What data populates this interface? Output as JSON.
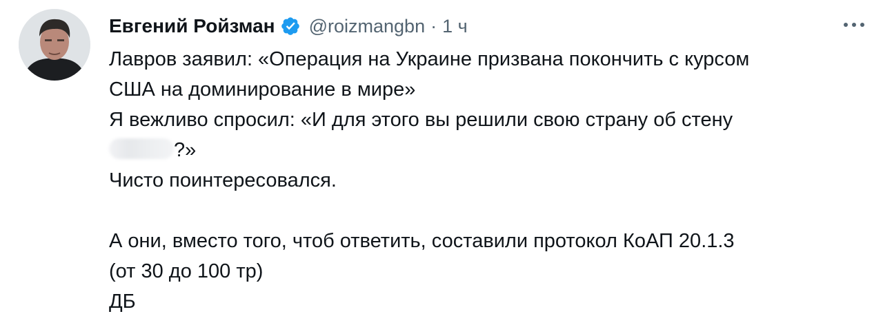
{
  "tweet": {
    "author_name": "Евгений Ройзман",
    "handle": "@roizmangbn",
    "separator": "·",
    "time": "1 ч",
    "more_label": "···",
    "lines": [
      "Лавров заявил: «Операция на Украине призвана покончить с курсом",
      "США на доминирование в мире»",
      "Я вежливо спросил: «И для этого вы решили свою страну об стену",
      "?»",
      "Чисто поинтересовался.",
      "",
      "А они, вместо того, чтоб ответить, составили протокол КоАП 20.1.3",
      "(от 30 до 100 тр)",
      "ДБ"
    ]
  },
  "icons": {
    "verified": "verified-badge-icon",
    "more": "more-dots-icon"
  },
  "colors": {
    "text": "#0f1419",
    "secondary": "#536471",
    "verified": "#1d9bf0",
    "background": "#ffffff"
  }
}
